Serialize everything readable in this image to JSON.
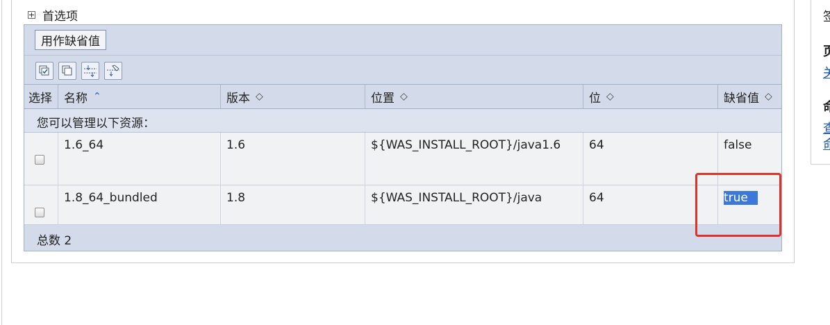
{
  "preferences": {
    "label": "首选项"
  },
  "actions": {
    "set_default_label": "用作缺省值"
  },
  "toolbar_icons": [
    "select-all-icon",
    "deselect-all-icon",
    "show-filter-icon",
    "clear-filter-icon"
  ],
  "table": {
    "headers": {
      "select": "选择",
      "name": "名称",
      "version": "版本",
      "location": "位置",
      "bits": "位",
      "default": "缺省值"
    },
    "sort_indicators": {
      "active": "⌃",
      "inactive": "◇"
    },
    "manage_text": "您可以管理以下资源：",
    "rows": [
      {
        "name": "1.6_64",
        "version": "1.6",
        "location": "${WAS_INSTALL_ROOT}/java1.6",
        "bits": "64",
        "default": "false",
        "selected": false
      },
      {
        "name": "1.8_64_bundled",
        "version": "1.8",
        "location": "${WAS_INSTALL_ROOT}/java",
        "bits": "64",
        "default": "true",
        "selected": false
      }
    ],
    "total_text": "总数 2"
  },
  "right_panel": {
    "line1": "签",
    "heading1": "页",
    "link1": "关",
    "heading2": "命",
    "link2": "查",
    "link3": "命"
  },
  "colors": {
    "grid_header_bg": "#d3dae9",
    "row_bg": "#f1f2f4",
    "selection": "#3c78d8",
    "highlight_box": "#e0302a",
    "link": "#1a57b3"
  }
}
